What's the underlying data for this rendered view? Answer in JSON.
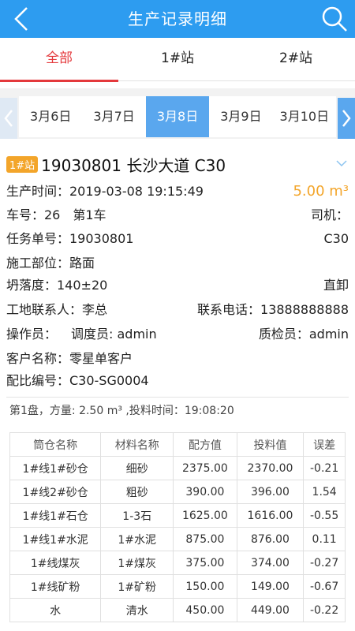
{
  "header": {
    "title": "生产记录明细",
    "back_icon": "back-arrow-icon",
    "search_icon": "search-icon"
  },
  "tabs": [
    {
      "label": "全部",
      "active": true
    },
    {
      "label": "1#站",
      "active": false
    },
    {
      "label": "2#站",
      "active": false
    }
  ],
  "dates": [
    {
      "label": "3月6日",
      "active": false
    },
    {
      "label": "3月7日",
      "active": false
    },
    {
      "label": "3月8日",
      "active": true
    },
    {
      "label": "3月9日",
      "active": false
    },
    {
      "label": "3月10日",
      "active": false
    }
  ],
  "record": {
    "station_badge": "1#站",
    "order_line": "19030801 长沙大道 C30",
    "production_time": "生产时间：2019-03-08 19:15:49",
    "volume": "5.00 m³",
    "vehicle": "车号：26　第1车",
    "driver": "司机：",
    "task_no": "任务单号：19030801",
    "grade": "C30",
    "site": "施工部位：路面",
    "slump": "坍落度：140±20",
    "unload": "直卸",
    "contact": "工地联系人：李总",
    "phone": "联系电话：13888888888",
    "operator": "操作员：",
    "dispatcher": "调度员: admin",
    "inspector": "质检员：admin",
    "customer": "客户名称：零星单客户",
    "mix_no": "配比编号：C30-SG0004"
  },
  "batch": {
    "summary": "第1盘，方量: 2.50 m³ ,投料时间：19:08:20",
    "columns": [
      "筒仓名称",
      "材料名称",
      "配方值",
      "投料值",
      "误差"
    ],
    "rows": [
      [
        "1#线1#砂仓",
        "细砂",
        "2375.00",
        "2370.00",
        "-0.21"
      ],
      [
        "1#线2#砂仓",
        "粗砂",
        "390.00",
        "396.00",
        "1.54"
      ],
      [
        "1#线1#石仓",
        "1-3石",
        "1625.00",
        "1616.00",
        "-0.55"
      ],
      [
        "1#线1#水泥",
        "1#水泥",
        "875.00",
        "876.00",
        "0.11"
      ],
      [
        "1#线煤灰",
        "1#煤灰",
        "375.00",
        "374.00",
        "-0.27"
      ],
      [
        "1#线矿粉",
        "1#矿粉",
        "150.00",
        "149.00",
        "-0.67"
      ],
      [
        "水",
        "清水",
        "450.00",
        "449.00",
        "-0.22"
      ]
    ]
  },
  "colors": {
    "header_bg": "#2d9cf0",
    "active_tab": "#e4393c",
    "active_date": "#5aa7ee",
    "accent_orange": "#f3a52a"
  }
}
